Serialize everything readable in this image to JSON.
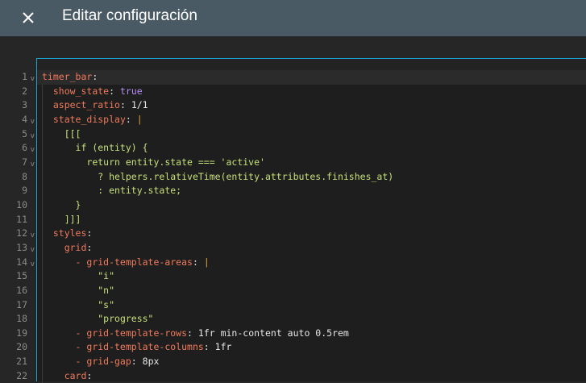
{
  "header": {
    "title": "Editar configuración",
    "close_icon": "close-icon"
  },
  "colors": {
    "accent": "#1aa3d6",
    "header": "#4a5a65",
    "key": "#f07a5c",
    "string": "#c5e07a",
    "boolean": "#b78ef0"
  },
  "editor": {
    "active_line": 1,
    "folds": [
      1,
      4,
      5,
      6,
      7,
      12,
      13,
      14
    ],
    "lines": [
      [
        [
          "",
          "timer_bar"
        ],
        [
          "k",
          "timer_bar"
        ],
        [
          "p",
          ":"
        ]
      ],
      [
        [
          "",
          "  "
        ],
        [
          "k",
          "show_state"
        ],
        [
          "p",
          ": "
        ],
        [
          "b",
          "true"
        ]
      ],
      [
        [
          "",
          "  "
        ],
        [
          "k",
          "aspect_ratio"
        ],
        [
          "p",
          ": "
        ],
        [
          "n",
          "1/1"
        ]
      ],
      [
        [
          "",
          "  "
        ],
        [
          "k",
          "state_display"
        ],
        [
          "p",
          ": "
        ],
        [
          "bar",
          "|"
        ]
      ],
      [
        [
          "",
          "    "
        ],
        [
          "s",
          "[[["
        ]
      ],
      [
        [
          "",
          "      "
        ],
        [
          "s",
          "if (entity) {"
        ]
      ],
      [
        [
          "",
          "        "
        ],
        [
          "s",
          "return entity.state === 'active'"
        ]
      ],
      [
        [
          "",
          "          "
        ],
        [
          "s",
          "? helpers.relativeTime(entity.attributes.finishes_at)"
        ]
      ],
      [
        [
          "",
          "          "
        ],
        [
          "s",
          ": entity.state;"
        ]
      ],
      [
        [
          "",
          "      "
        ],
        [
          "s",
          "}"
        ]
      ],
      [
        [
          "",
          "    "
        ],
        [
          "s",
          "]]]"
        ]
      ],
      [
        [
          "",
          "  "
        ],
        [
          "k",
          "styles"
        ],
        [
          "p",
          ":"
        ]
      ],
      [
        [
          "",
          "    "
        ],
        [
          "k",
          "grid"
        ],
        [
          "p",
          ":"
        ]
      ],
      [
        [
          "",
          "      "
        ],
        [
          "k",
          "- grid-template-areas"
        ],
        [
          "p",
          ": "
        ],
        [
          "bar",
          "|"
        ]
      ],
      [
        [
          "",
          "          "
        ],
        [
          "s",
          "\"i\""
        ]
      ],
      [
        [
          "",
          "          "
        ],
        [
          "s",
          "\"n\""
        ]
      ],
      [
        [
          "",
          "          "
        ],
        [
          "s",
          "\"s\""
        ]
      ],
      [
        [
          "",
          "          "
        ],
        [
          "s",
          "\"progress\""
        ]
      ],
      [
        [
          "",
          "      "
        ],
        [
          "k",
          "- grid-template-rows"
        ],
        [
          "p",
          ": "
        ],
        [
          "n",
          "1fr min-content auto 0.5rem"
        ]
      ],
      [
        [
          "",
          "      "
        ],
        [
          "k",
          "- grid-template-columns"
        ],
        [
          "p",
          ": "
        ],
        [
          "n",
          "1fr"
        ]
      ],
      [
        [
          "",
          "      "
        ],
        [
          "k",
          "- grid-gap"
        ],
        [
          "p",
          ": "
        ],
        [
          "n",
          "8px"
        ]
      ],
      [
        [
          "",
          "    "
        ],
        [
          "k",
          "card"
        ],
        [
          "p",
          ":"
        ]
      ]
    ]
  }
}
